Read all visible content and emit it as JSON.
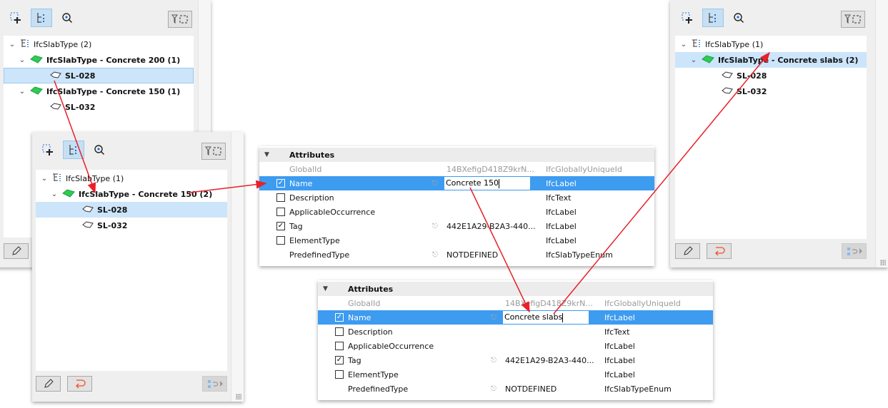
{
  "colors": {
    "accent": "#3d9bf0",
    "selection": "#cce5fa",
    "arrow": "#e8202a",
    "type_icon": "#2ecc55",
    "undo_icon": "#f0502a"
  },
  "panels": [
    {
      "id": "before",
      "tree": [
        {
          "level": 0,
          "label": "IfcSlabType (2)",
          "bold": false,
          "icon": "type-group-icon",
          "chevron": true
        },
        {
          "level": 1,
          "label": "IfcSlabType - Concrete 200 (1)",
          "bold": true,
          "icon": "slab-type-icon",
          "chevron": true
        },
        {
          "level": 2,
          "label": "SL-028",
          "bold": true,
          "icon": "slab-icon",
          "selected": "border"
        },
        {
          "level": 1,
          "label": "IfcSlabType - Concrete 150 (1)",
          "bold": true,
          "icon": "slab-type-icon",
          "chevron": true
        },
        {
          "level": 2,
          "label": "SL-032",
          "bold": true,
          "icon": "slab-icon"
        }
      ],
      "undo": false
    },
    {
      "id": "middle",
      "tree": [
        {
          "level": 0,
          "label": "IfcSlabType (1)",
          "bold": false,
          "icon": "type-group-icon",
          "chevron": true
        },
        {
          "level": 1,
          "label": "IfcSlabType - Concrete 150 (2)",
          "bold": true,
          "icon": "slab-type-icon",
          "chevron": true
        },
        {
          "level": 2,
          "label": "SL-028",
          "bold": true,
          "icon": "slab-icon",
          "selected": "fill"
        },
        {
          "level": 2,
          "label": "SL-032",
          "bold": true,
          "icon": "slab-icon"
        }
      ],
      "undo": true
    },
    {
      "id": "after",
      "tree": [
        {
          "level": 0,
          "label": "IfcSlabType (1)",
          "bold": false,
          "icon": "type-group-icon",
          "chevron": true
        },
        {
          "level": 1,
          "label": "IfcSlabType - Concrete slabs (2)",
          "bold": true,
          "icon": "slab-type-icon",
          "chevron": true,
          "selected": "fill"
        },
        {
          "level": 2,
          "label": "SL-028",
          "bold": true,
          "icon": "slab-icon"
        },
        {
          "level": 2,
          "label": "SL-032",
          "bold": true,
          "icon": "slab-icon"
        }
      ],
      "undo": true
    }
  ],
  "attributes": [
    {
      "header": "Attributes",
      "rows": [
        {
          "name": "GlobalId",
          "value": "14BXefigD418Z9krN...",
          "type": "IfcGloballyUniqueId",
          "checkbox": null,
          "gray": true
        },
        {
          "name": "Name",
          "value": "Concrete 150",
          "type": "IfcLabel",
          "checkbox": true,
          "link": true,
          "editing": true,
          "selected": true
        },
        {
          "name": "Description",
          "value": "",
          "type": "IfcText",
          "checkbox": false
        },
        {
          "name": "ApplicableOccurrence",
          "value": "",
          "type": "IfcLabel",
          "checkbox": false
        },
        {
          "name": "Tag",
          "value": "442E1A29-B2A3-440...",
          "type": "IfcLabel",
          "checkbox": true,
          "link": true
        },
        {
          "name": "ElementType",
          "value": "",
          "type": "IfcLabel",
          "checkbox": false
        },
        {
          "name": "PredefinedType",
          "value": "NOTDEFINED",
          "type": "IfcSlabTypeEnum",
          "checkbox": null,
          "link": true
        }
      ]
    },
    {
      "header": "Attributes",
      "rows": [
        {
          "name": "GlobalId",
          "value": "14BXefigD418Z9krN...",
          "type": "IfcGloballyUniqueId",
          "checkbox": null,
          "gray": true
        },
        {
          "name": "Name",
          "value": "Concrete slabs",
          "type": "IfcLabel",
          "checkbox": true,
          "link": true,
          "editing": true,
          "selected": true
        },
        {
          "name": "Description",
          "value": "",
          "type": "IfcText",
          "checkbox": false
        },
        {
          "name": "ApplicableOccurrence",
          "value": "",
          "type": "IfcLabel",
          "checkbox": false
        },
        {
          "name": "Tag",
          "value": "442E1A29-B2A3-440...",
          "type": "IfcLabel",
          "checkbox": true,
          "link": true
        },
        {
          "name": "ElementType",
          "value": "",
          "type": "IfcLabel",
          "checkbox": false
        },
        {
          "name": "PredefinedType",
          "value": "NOTDEFINED",
          "type": "IfcSlabTypeEnum",
          "checkbox": null,
          "link": true
        }
      ]
    }
  ]
}
